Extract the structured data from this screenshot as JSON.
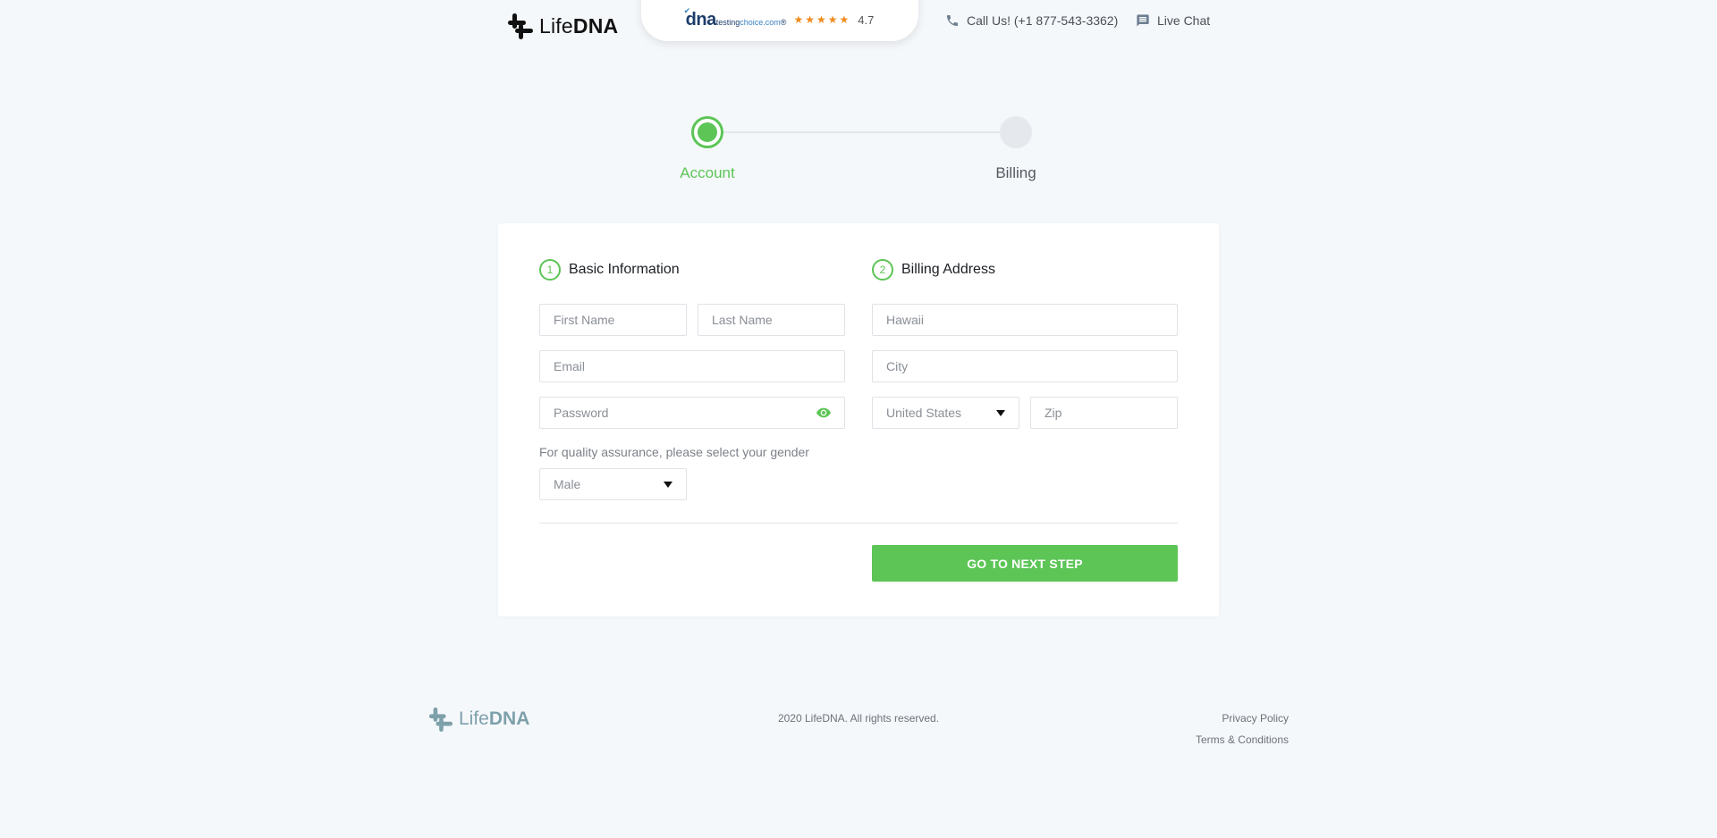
{
  "header": {
    "logo": {
      "light": "Life",
      "bold": "DNA"
    },
    "badge": {
      "brand_big": "dna",
      "brand_small_1": "testing",
      "brand_small_2": "choice.com",
      "brand_reg": "®",
      "stars": "★★★★★",
      "rating": "4.7"
    },
    "call_label": "Call Us! (+1 877-543-3362)",
    "chat_label": "Live Chat"
  },
  "stepper": {
    "steps": [
      {
        "label": "Account",
        "state": "active"
      },
      {
        "label": "Billing",
        "state": "inactive"
      }
    ]
  },
  "form": {
    "basic": {
      "number": "1",
      "title": "Basic Information",
      "first_name_placeholder": "First Name",
      "last_name_placeholder": "Last Name",
      "email_placeholder": "Email",
      "password_placeholder": "Password",
      "gender_note": "For quality assurance, please select your gender",
      "gender_value": "Male"
    },
    "billing": {
      "number": "2",
      "title": "Billing Address",
      "state_value": "Hawaii",
      "city_placeholder": "City",
      "country_value": "United States",
      "zip_placeholder": "Zip"
    },
    "next_button": "GO TO NEXT STEP"
  },
  "footer": {
    "logo": {
      "light": "Life",
      "bold": "DNA"
    },
    "copyright": "2020 LifeDNA. All rights reserved.",
    "privacy": "Privacy Policy",
    "terms": "Terms & Conditions"
  },
  "colors": {
    "accent": "#5cc556",
    "background": "#f5f8fb",
    "footer_logo": "#7ea0ab"
  },
  "icons": [
    "lifedna-logo-icon",
    "phone-icon",
    "chat-icon",
    "eye-icon",
    "caret-down-icon",
    "verified-check-icon",
    "star-icon"
  ]
}
